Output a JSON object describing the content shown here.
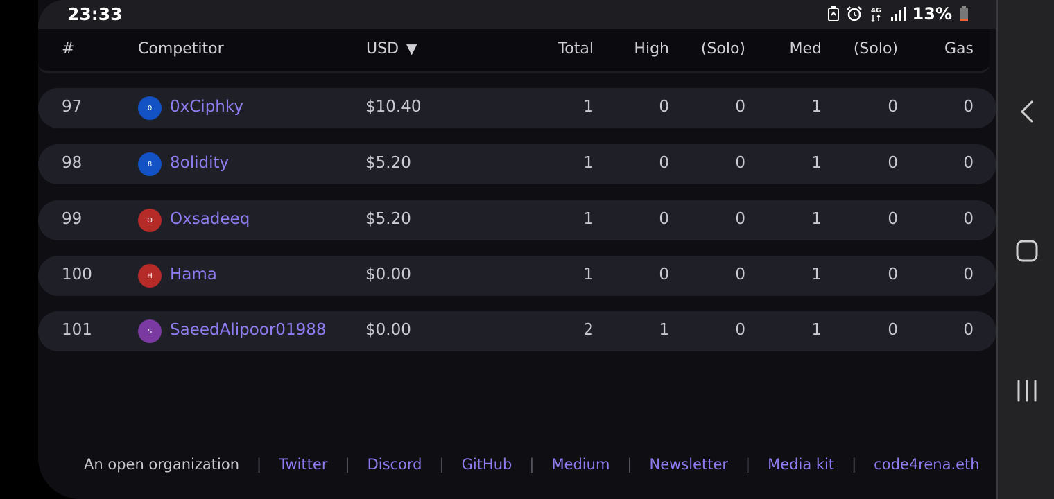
{
  "status_bar": {
    "time": "23:33",
    "network": "4G",
    "battery": "13%",
    "icons": [
      "battery-saver-icon",
      "alarm-icon",
      "network-4g-icon",
      "signal-icon",
      "battery-icon"
    ]
  },
  "table": {
    "headers": {
      "rank": "#",
      "competitor": "Competitor",
      "usd": "USD",
      "usd_sort": "▼",
      "total": "Total",
      "high": "High",
      "high_solo": "(Solo)",
      "med": "Med",
      "med_solo": "(Solo)",
      "gas": "Gas"
    },
    "rows": [
      {
        "rank": "97",
        "avatar": "0",
        "avatar_color": "#1352c5",
        "name": "0xCiphky",
        "usd": "$10.40",
        "total": "1",
        "high": "0",
        "high_solo": "0",
        "med": "1",
        "med_solo": "0",
        "gas": "0"
      },
      {
        "rank": "98",
        "avatar": "8",
        "avatar_color": "#1352c5",
        "name": "8olidity",
        "usd": "$5.20",
        "total": "1",
        "high": "0",
        "high_solo": "0",
        "med": "1",
        "med_solo": "0",
        "gas": "0"
      },
      {
        "rank": "99",
        "avatar": "O",
        "avatar_color": "#b42b27",
        "name": "Oxsadeeq",
        "usd": "$5.20",
        "total": "1",
        "high": "0",
        "high_solo": "0",
        "med": "1",
        "med_solo": "0",
        "gas": "0"
      },
      {
        "rank": "100",
        "avatar": "H",
        "avatar_color": "#b42b27",
        "name": "Hama",
        "usd": "$0.00",
        "total": "1",
        "high": "0",
        "high_solo": "0",
        "med": "1",
        "med_solo": "0",
        "gas": "0"
      },
      {
        "rank": "101",
        "avatar": "S",
        "avatar_color": "#7b3aa1",
        "name": "SaeedAlipoor01988",
        "usd": "$0.00",
        "total": "2",
        "high": "1",
        "high_solo": "0",
        "med": "1",
        "med_solo": "0",
        "gas": "0"
      }
    ]
  },
  "footer": {
    "lead": "An open organization",
    "links": [
      "Twitter",
      "Discord",
      "GitHub",
      "Medium",
      "Newsletter",
      "Media kit",
      "code4rena.eth"
    ]
  },
  "nav_bar": {
    "icons": [
      "back-icon",
      "home-icon",
      "recent-apps-icon"
    ]
  },
  "colors": {
    "accent_link": "#8f7cf0",
    "row_bg": "#1f1f28",
    "page_bg": "#0f0f13"
  }
}
